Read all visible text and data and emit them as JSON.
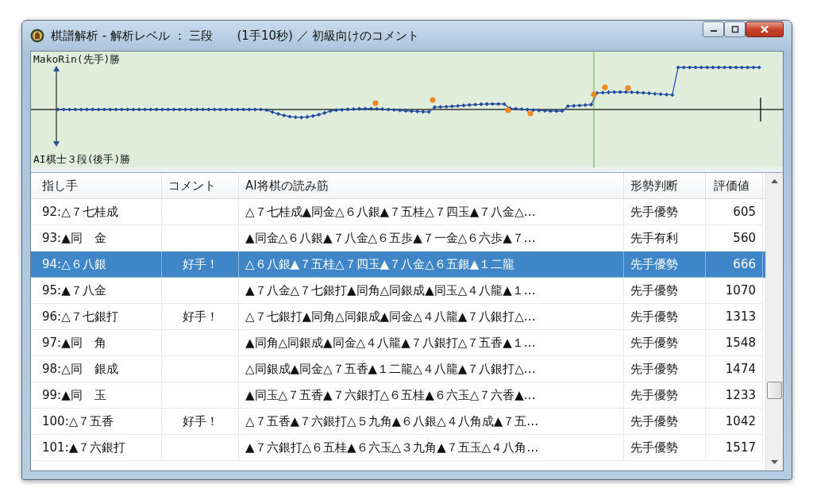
{
  "window": {
    "title": "棋譜解析 - 解析レベル ： 三段　　(1手10秒) ／ 初級向けのコメント"
  },
  "chart": {
    "top_label": "MakoRin(先手)勝",
    "bottom_label": "AI棋士３段(後手)勝"
  },
  "table": {
    "columns": [
      "指し手",
      "コメント",
      "AI将棋の読み筋",
      "形勢判断",
      "評価値"
    ],
    "rows": [
      {
        "move": "92:△７七桂成",
        "comment": "",
        "pv": "△７七桂成▲同金△６八銀▲７五桂△７四玉▲７八金△…",
        "judgment": "先手優勢",
        "eval": "605",
        "selected": false
      },
      {
        "move": "93:▲同　金",
        "comment": "",
        "pv": "▲同金△６八銀▲７八金△６五歩▲７一金△６六歩▲７…",
        "judgment": "先手有利",
        "eval": "560",
        "selected": false
      },
      {
        "move": "94:△６八銀",
        "comment": "好手！",
        "pv": "△６八銀▲７五桂△７四玉▲７八金△６五銀▲１二龍",
        "judgment": "先手優勢",
        "eval": "666",
        "selected": true
      },
      {
        "move": "95:▲７八金",
        "comment": "",
        "pv": "▲７八金△７七銀打▲同角△同銀成▲同玉△４八龍▲１…",
        "judgment": "先手優勢",
        "eval": "1070",
        "selected": false
      },
      {
        "move": "96:△７七銀打",
        "comment": "好手！",
        "pv": "△７七銀打▲同角△同銀成▲同金△４八龍▲７八銀打△…",
        "judgment": "先手優勢",
        "eval": "1313",
        "selected": false
      },
      {
        "move": "97:▲同　角",
        "comment": "",
        "pv": "▲同角△同銀成▲同金△４八龍▲７八銀打△７五香▲１…",
        "judgment": "先手優勢",
        "eval": "1548",
        "selected": false
      },
      {
        "move": "98:△同　銀成",
        "comment": "",
        "pv": "△同銀成▲同金△７五香▲１二龍△４八龍▲７八銀打△…",
        "judgment": "先手優勢",
        "eval": "1474",
        "selected": false
      },
      {
        "move": "99:▲同　玉",
        "comment": "",
        "pv": "▲同玉△７五香▲７六銀打△６五桂▲６六玉△７六香▲…",
        "judgment": "先手優勢",
        "eval": "1233",
        "selected": false
      },
      {
        "move": "100:△７五香",
        "comment": "好手！",
        "pv": "△７五香▲７六銀打△５九角▲６八銀△４八角成▲７五…",
        "judgment": "先手優勢",
        "eval": "1042",
        "selected": false
      },
      {
        "move": "101:▲７六銀打",
        "comment": "",
        "pv": "▲７六銀打△６五桂▲６六玉△３九角▲７五玉△４八角…",
        "judgment": "先手優勢",
        "eval": "1517",
        "selected": false
      }
    ]
  }
}
